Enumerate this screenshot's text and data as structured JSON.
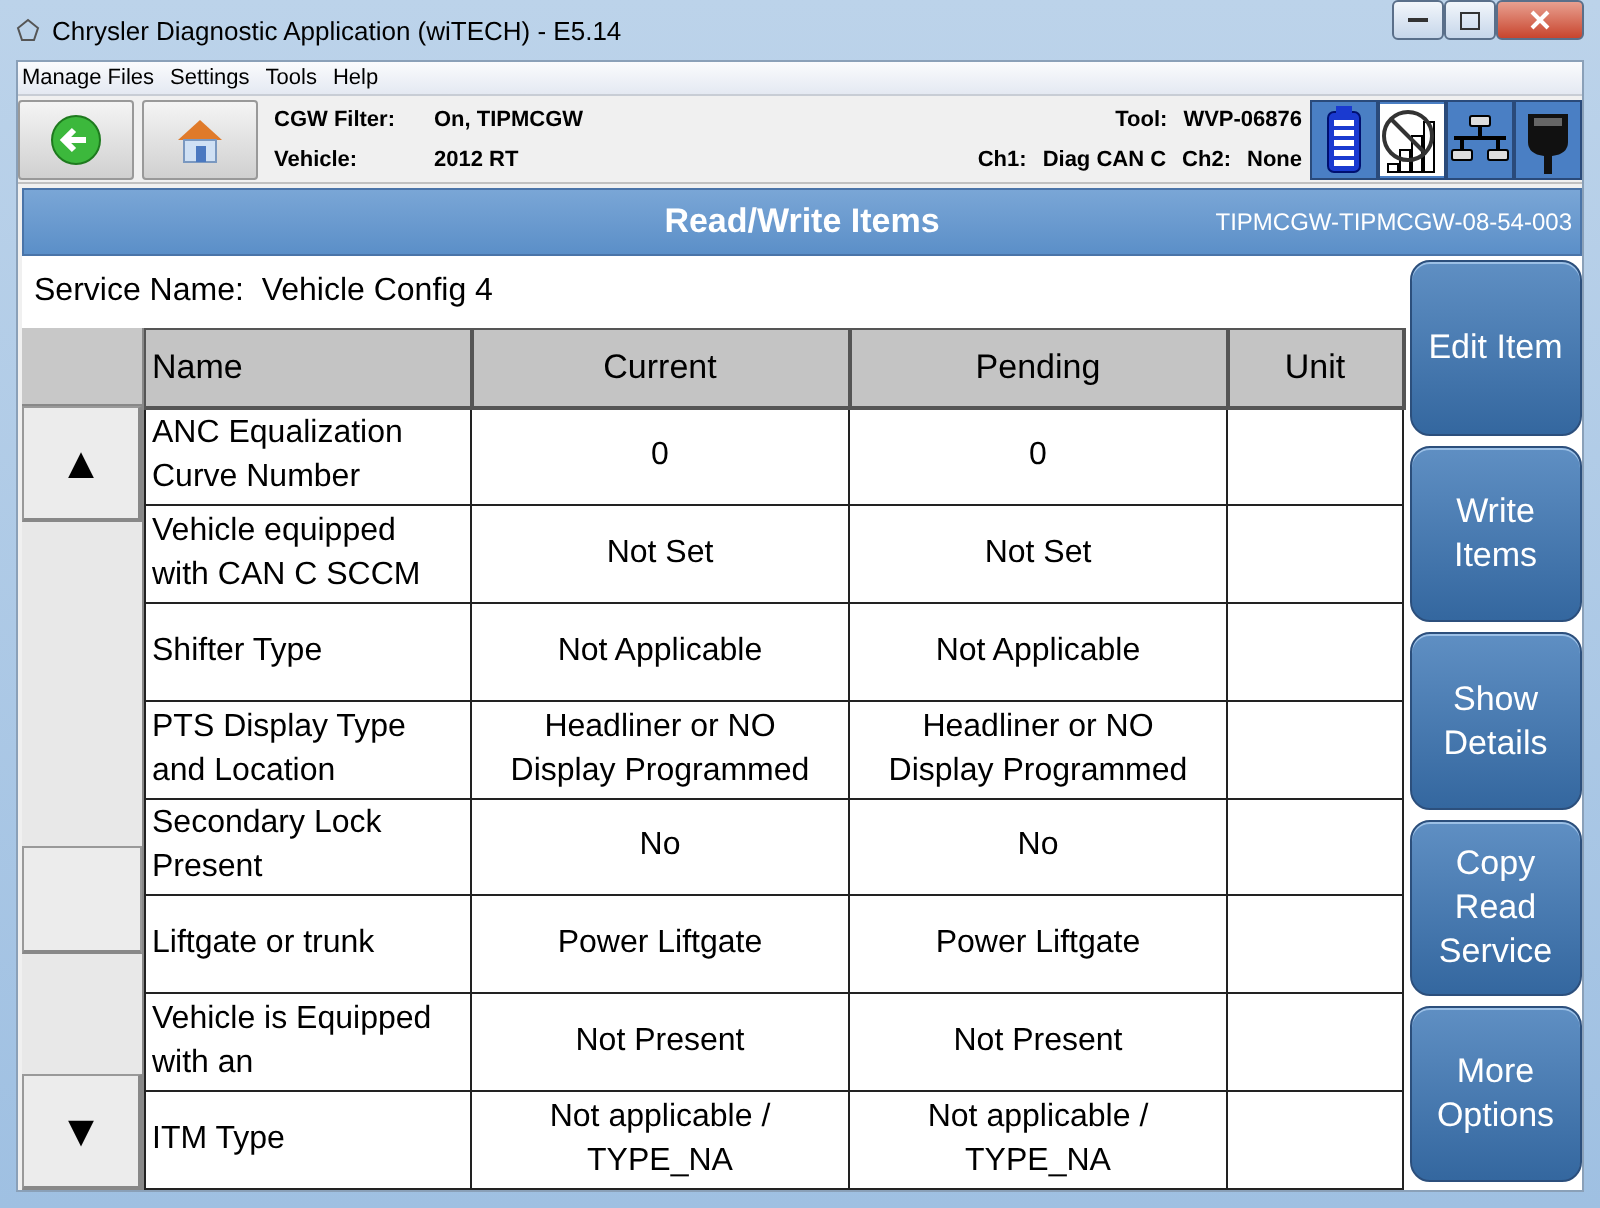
{
  "window": {
    "title": "Chrysler Diagnostic Application (wiTECH) - E5.14"
  },
  "menu": [
    "Manage Files",
    "Settings",
    "Tools",
    "Help"
  ],
  "toolbar": {
    "info_left": [
      {
        "label": "CGW Filter:",
        "value": "On, TIPMCGW"
      },
      {
        "label": "Vehicle:",
        "value": "2012 RT"
      }
    ],
    "tool": {
      "label": "Tool:",
      "value": "WVP-06876"
    },
    "channels": [
      {
        "label": "Ch1:",
        "value": "Diag CAN C"
      },
      {
        "label": "Ch2:",
        "value": "None"
      }
    ]
  },
  "header": {
    "title": "Read/Write Items",
    "code": "TIPMCGW-TIPMCGW-08-54-003"
  },
  "service": {
    "label": "Service Name:",
    "value": "Vehicle Config 4"
  },
  "table": {
    "columns": [
      "Name",
      "Current",
      "Pending",
      "Unit"
    ],
    "rows": [
      {
        "name": "ANC Equalization Curve Number",
        "current": "0",
        "pending": "0"
      },
      {
        "name": "Vehicle equipped with CAN C SCCM",
        "current": "Not Set",
        "pending": "Not Set"
      },
      {
        "name": "Shifter Type",
        "current": "Not Applicable",
        "pending": "Not Applicable"
      },
      {
        "name": "PTS Display Type and Location",
        "current": "Headliner or NO Display Programmed",
        "pending": "Headliner or NO Display Programmed"
      },
      {
        "name": "Secondary Lock Present",
        "current": "No",
        "pending": "No"
      },
      {
        "name": "Liftgate or trunk",
        "current": "Power Liftgate",
        "pending": "Power Liftgate"
      },
      {
        "name": "Vehicle is Equipped with an",
        "current": "Not Present",
        "pending": "Not Present"
      },
      {
        "name": "ITM Type",
        "current": "Not applicable / TYPE_NA",
        "pending": "Not applicable / TYPE_NA"
      }
    ]
  },
  "scroll": {
    "up": "▲",
    "down": "▼"
  },
  "actions": [
    "Edit Item",
    "Write Items",
    "Show Details",
    "Copy Read Service",
    "More Options"
  ]
}
